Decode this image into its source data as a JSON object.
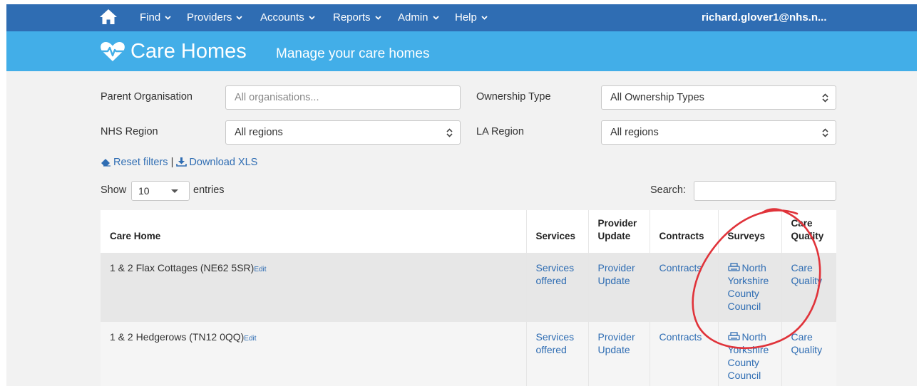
{
  "topnav": {
    "home_icon": "home-icon",
    "items": [
      {
        "label": "Find"
      },
      {
        "label": "Providers"
      },
      {
        "label": "Accounts"
      },
      {
        "label": "Reports"
      },
      {
        "label": "Admin"
      },
      {
        "label": "Help"
      }
    ],
    "user": "richard.glover1@nhs.n..."
  },
  "banner": {
    "icon": "heart-pulse-icon",
    "title": "Care Homes",
    "subtitle": "Manage your care homes"
  },
  "filters": {
    "parent_org_label": "Parent Organisation",
    "parent_org_placeholder": "All organisations...",
    "ownership_label": "Ownership Type",
    "ownership_value": "All Ownership Types",
    "nhs_region_label": "NHS Region",
    "nhs_region_value": "All regions",
    "la_region_label": "LA Region",
    "la_region_value": "All regions",
    "reset_label": "Reset filters",
    "separator": "|",
    "download_label": "Download XLS"
  },
  "table_controls": {
    "show_label": "Show",
    "entries_value": "10",
    "entries_label": "entries",
    "search_label": "Search:"
  },
  "table": {
    "headers": [
      "Care Home",
      "Services",
      "Provider Update",
      "Contracts",
      "Surveys",
      "Care Quality"
    ],
    "rows": [
      {
        "name": "1 & 2 Flax Cottages (NE62 5SR)",
        "edit": "Edit",
        "services": "Services offered",
        "provider_update": "Provider Update",
        "contracts": "Contracts",
        "survey": "North Yorkshire County Council",
        "care_quality": "Care Quality"
      },
      {
        "name": "1 & 2 Hedgerows (TN12 0QQ)",
        "edit": "Edit",
        "services": "Services offered",
        "provider_update": "Provider Update",
        "contracts": "Contracts",
        "survey": "North Yorkshire County Council",
        "care_quality": "Care Quality"
      }
    ]
  },
  "colors": {
    "nav_bg": "#2f6db3",
    "banner_bg": "#42aee8",
    "link": "#2f6db3",
    "annotation": "#e0333a"
  }
}
